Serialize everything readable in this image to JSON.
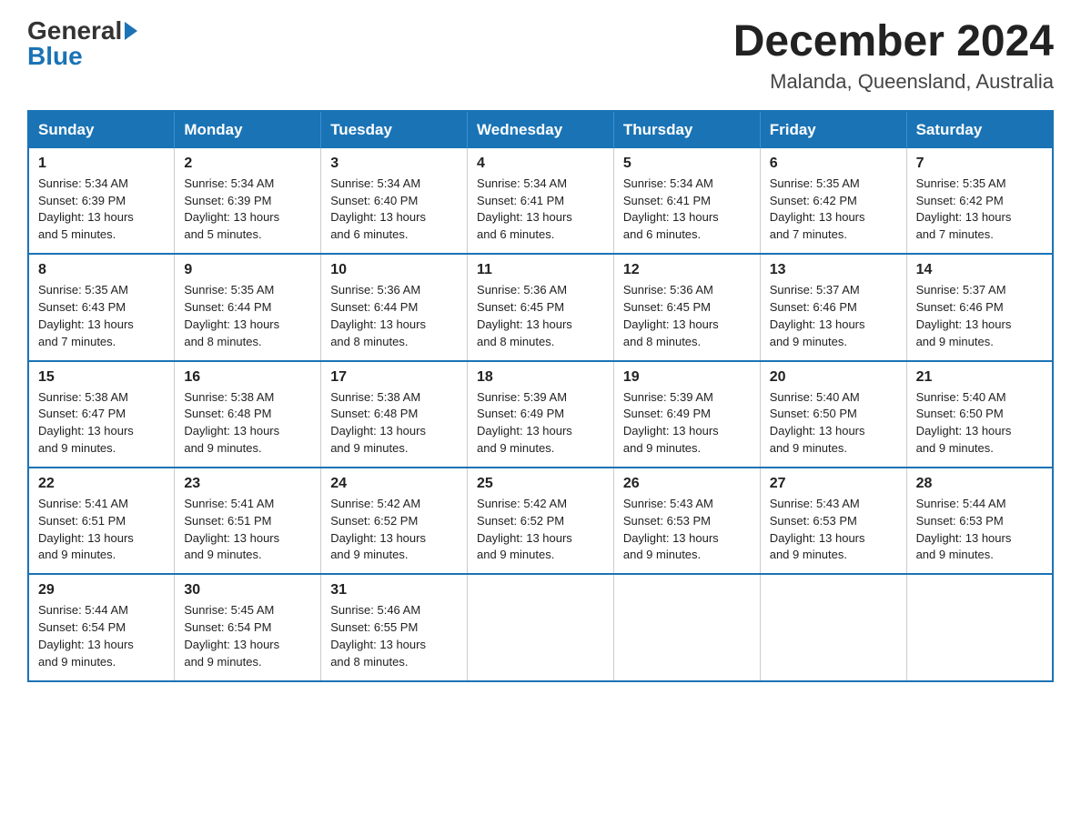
{
  "logo": {
    "general": "General",
    "blue": "Blue",
    "tagline": ""
  },
  "header": {
    "title": "December 2024",
    "subtitle": "Malanda, Queensland, Australia"
  },
  "weekdays": [
    "Sunday",
    "Monday",
    "Tuesday",
    "Wednesday",
    "Thursday",
    "Friday",
    "Saturday"
  ],
  "weeks": [
    [
      {
        "day": "1",
        "info": "Sunrise: 5:34 AM\nSunset: 6:39 PM\nDaylight: 13 hours\nand 5 minutes."
      },
      {
        "day": "2",
        "info": "Sunrise: 5:34 AM\nSunset: 6:39 PM\nDaylight: 13 hours\nand 5 minutes."
      },
      {
        "day": "3",
        "info": "Sunrise: 5:34 AM\nSunset: 6:40 PM\nDaylight: 13 hours\nand 6 minutes."
      },
      {
        "day": "4",
        "info": "Sunrise: 5:34 AM\nSunset: 6:41 PM\nDaylight: 13 hours\nand 6 minutes."
      },
      {
        "day": "5",
        "info": "Sunrise: 5:34 AM\nSunset: 6:41 PM\nDaylight: 13 hours\nand 6 minutes."
      },
      {
        "day": "6",
        "info": "Sunrise: 5:35 AM\nSunset: 6:42 PM\nDaylight: 13 hours\nand 7 minutes."
      },
      {
        "day": "7",
        "info": "Sunrise: 5:35 AM\nSunset: 6:42 PM\nDaylight: 13 hours\nand 7 minutes."
      }
    ],
    [
      {
        "day": "8",
        "info": "Sunrise: 5:35 AM\nSunset: 6:43 PM\nDaylight: 13 hours\nand 7 minutes."
      },
      {
        "day": "9",
        "info": "Sunrise: 5:35 AM\nSunset: 6:44 PM\nDaylight: 13 hours\nand 8 minutes."
      },
      {
        "day": "10",
        "info": "Sunrise: 5:36 AM\nSunset: 6:44 PM\nDaylight: 13 hours\nand 8 minutes."
      },
      {
        "day": "11",
        "info": "Sunrise: 5:36 AM\nSunset: 6:45 PM\nDaylight: 13 hours\nand 8 minutes."
      },
      {
        "day": "12",
        "info": "Sunrise: 5:36 AM\nSunset: 6:45 PM\nDaylight: 13 hours\nand 8 minutes."
      },
      {
        "day": "13",
        "info": "Sunrise: 5:37 AM\nSunset: 6:46 PM\nDaylight: 13 hours\nand 9 minutes."
      },
      {
        "day": "14",
        "info": "Sunrise: 5:37 AM\nSunset: 6:46 PM\nDaylight: 13 hours\nand 9 minutes."
      }
    ],
    [
      {
        "day": "15",
        "info": "Sunrise: 5:38 AM\nSunset: 6:47 PM\nDaylight: 13 hours\nand 9 minutes."
      },
      {
        "day": "16",
        "info": "Sunrise: 5:38 AM\nSunset: 6:48 PM\nDaylight: 13 hours\nand 9 minutes."
      },
      {
        "day": "17",
        "info": "Sunrise: 5:38 AM\nSunset: 6:48 PM\nDaylight: 13 hours\nand 9 minutes."
      },
      {
        "day": "18",
        "info": "Sunrise: 5:39 AM\nSunset: 6:49 PM\nDaylight: 13 hours\nand 9 minutes."
      },
      {
        "day": "19",
        "info": "Sunrise: 5:39 AM\nSunset: 6:49 PM\nDaylight: 13 hours\nand 9 minutes."
      },
      {
        "day": "20",
        "info": "Sunrise: 5:40 AM\nSunset: 6:50 PM\nDaylight: 13 hours\nand 9 minutes."
      },
      {
        "day": "21",
        "info": "Sunrise: 5:40 AM\nSunset: 6:50 PM\nDaylight: 13 hours\nand 9 minutes."
      }
    ],
    [
      {
        "day": "22",
        "info": "Sunrise: 5:41 AM\nSunset: 6:51 PM\nDaylight: 13 hours\nand 9 minutes."
      },
      {
        "day": "23",
        "info": "Sunrise: 5:41 AM\nSunset: 6:51 PM\nDaylight: 13 hours\nand 9 minutes."
      },
      {
        "day": "24",
        "info": "Sunrise: 5:42 AM\nSunset: 6:52 PM\nDaylight: 13 hours\nand 9 minutes."
      },
      {
        "day": "25",
        "info": "Sunrise: 5:42 AM\nSunset: 6:52 PM\nDaylight: 13 hours\nand 9 minutes."
      },
      {
        "day": "26",
        "info": "Sunrise: 5:43 AM\nSunset: 6:53 PM\nDaylight: 13 hours\nand 9 minutes."
      },
      {
        "day": "27",
        "info": "Sunrise: 5:43 AM\nSunset: 6:53 PM\nDaylight: 13 hours\nand 9 minutes."
      },
      {
        "day": "28",
        "info": "Sunrise: 5:44 AM\nSunset: 6:53 PM\nDaylight: 13 hours\nand 9 minutes."
      }
    ],
    [
      {
        "day": "29",
        "info": "Sunrise: 5:44 AM\nSunset: 6:54 PM\nDaylight: 13 hours\nand 9 minutes."
      },
      {
        "day": "30",
        "info": "Sunrise: 5:45 AM\nSunset: 6:54 PM\nDaylight: 13 hours\nand 9 minutes."
      },
      {
        "day": "31",
        "info": "Sunrise: 5:46 AM\nSunset: 6:55 PM\nDaylight: 13 hours\nand 8 minutes."
      },
      {
        "day": "",
        "info": ""
      },
      {
        "day": "",
        "info": ""
      },
      {
        "day": "",
        "info": ""
      },
      {
        "day": "",
        "info": ""
      }
    ]
  ]
}
